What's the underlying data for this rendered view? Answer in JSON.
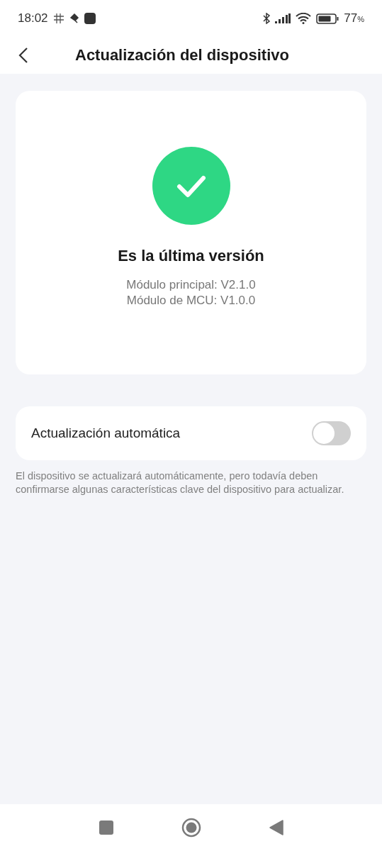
{
  "status_bar": {
    "time": "18:02",
    "battery": "77",
    "battery_unit": "%"
  },
  "header": {
    "title": "Actualización del dispositivo"
  },
  "status_card": {
    "title": "Es la última versión",
    "versions": [
      "Módulo principal: V2.1.0",
      "Módulo de MCU: V1.0.0"
    ]
  },
  "auto_update": {
    "label": "Actualización automática",
    "on": false
  },
  "note": "El dispositivo se actualizará automáticamente, pero todavía deben confirmarse algunas características clave del dispositivo para actualizar."
}
